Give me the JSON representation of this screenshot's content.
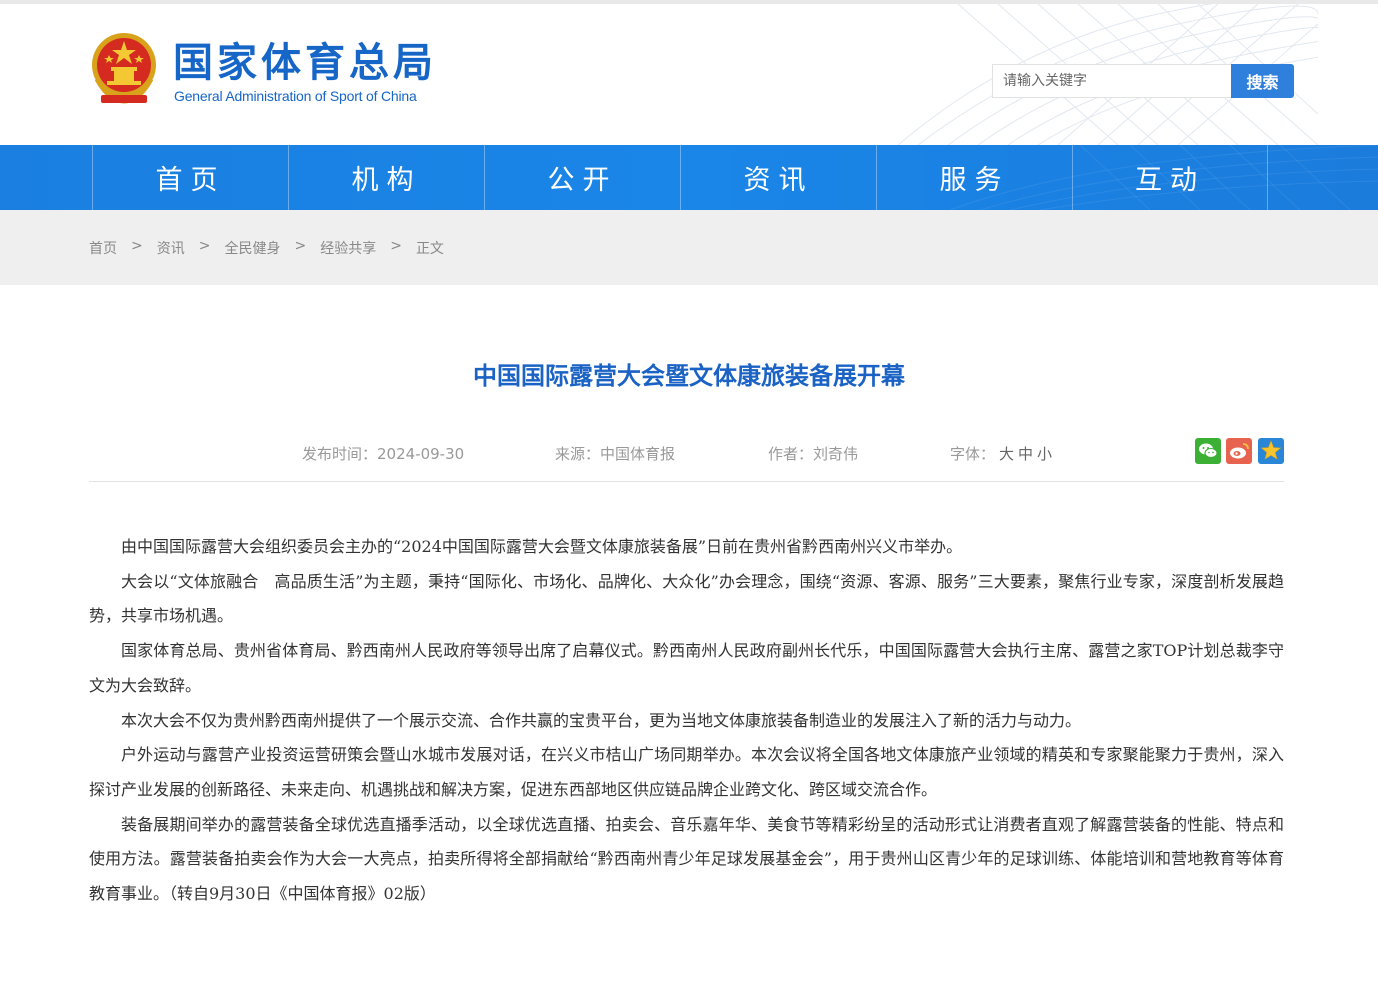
{
  "header": {
    "site_title": "国家体育总局",
    "site_subtitle": "General Administration of Sport of China",
    "search_placeholder": "请输入关键字",
    "search_button": "搜索"
  },
  "nav": {
    "items": [
      "首页",
      "机构",
      "公开",
      "资讯",
      "服务",
      "互动"
    ]
  },
  "breadcrumb": {
    "items": [
      "首页",
      "资讯",
      "全民健身",
      "经验共享",
      "正文"
    ],
    "separator": ">"
  },
  "article": {
    "title": "中国国际露营大会暨文体康旅装备展开幕",
    "date_label": "发布时间：2024-09-30",
    "source_label": "来源：中国体育报",
    "author_label": "作者：刘奇伟",
    "font_label": "字体：",
    "font_sizes": {
      "large": "大",
      "medium": "中",
      "small": "小"
    },
    "share_icons": {
      "wechat": "wechat-icon",
      "weibo": "weibo-icon",
      "favorite": "star-icon"
    },
    "paragraphs": [
      "由中国国际露营大会组织委员会主办的“2024中国国际露营大会暨文体康旅装备展”日前在贵州省黔西南州兴义市举办。",
      "大会以“文体旅融合　高品质生活”为主题，秉持“国际化、市场化、品牌化、大众化”办会理念，围绕“资源、客源、服务”三大要素，聚焦行业专家，深度剖析发展趋势，共享市场机遇。",
      "国家体育总局、贵州省体育局、黔西南州人民政府等领导出席了启幕仪式。黔西南州人民政府副州长代乐，中国国际露营大会执行主席、露营之家TOP计划总裁李守文为大会致辞。",
      "本次大会不仅为贵州黔西南州提供了一个展示交流、合作共赢的宝贵平台，更为当地文体康旅装备制造业的发展注入了新的活力与动力。",
      "户外运动与露营产业投资运营研策会暨山水城市发展对话，在兴义市桔山广场同期举办。本次会议将全国各地文体康旅产业领域的精英和专家聚能聚力于贵州，深入探讨产业发展的创新路径、未来走向、机遇挑战和解决方案，促进东西部地区供应链品牌企业跨文化、跨区域交流合作。",
      "装备展期间举办的露营装备全球优选直播季活动，以全球优选直播、拍卖会、音乐嘉年华、美食节等精彩纷呈的活动形式让消费者直观了解露营装备的性能、特点和使用方法。露营装备拍卖会作为大会一大亮点，拍卖所得将全部捐献给“黔西南州青少年足球发展基金会”，用于贵州山区青少年的足球训练、体能培训和营地教育等体育教育事业。（转自9月30日《中国体育报》02版）"
    ]
  },
  "colors": {
    "brand_blue": "#1666c8",
    "nav_blue": "#1a86e8",
    "title_blue": "#1a62c4",
    "search_button": "#2f7fdc"
  }
}
